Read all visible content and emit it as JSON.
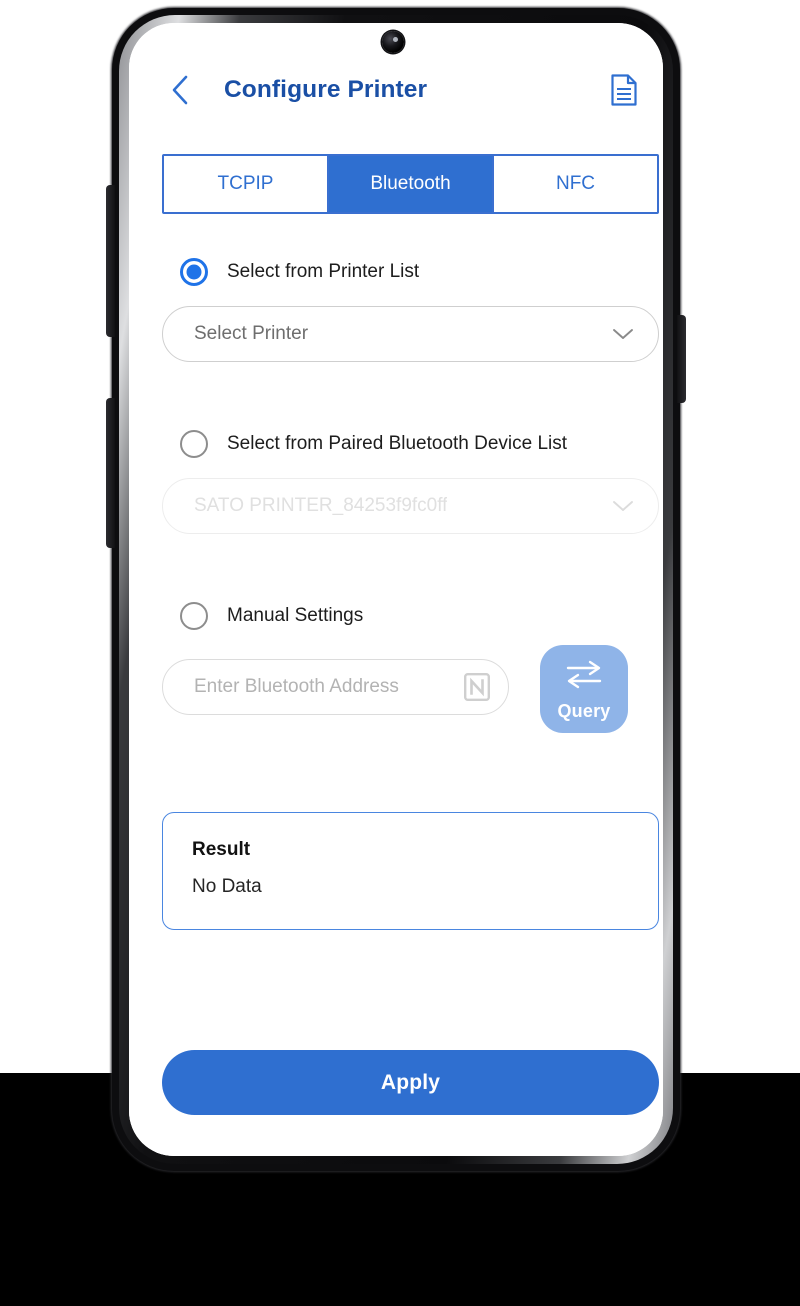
{
  "device": {
    "type": "smartphone",
    "camera": "front-camera-punch-hole"
  },
  "header": {
    "back_icon": "chevron-left-icon",
    "title": "Configure Printer",
    "action_icon": "document-icon"
  },
  "tabs": [
    {
      "label": "TCPIP",
      "active": false
    },
    {
      "label": "Bluetooth",
      "active": true
    },
    {
      "label": "NFC",
      "active": false
    }
  ],
  "options": [
    {
      "label": "Select from Printer List",
      "selected": true,
      "dropdown": {
        "value": "Select Printer",
        "disabled": false,
        "icon": "chevron-down-icon"
      }
    },
    {
      "label": "Select from Paired Bluetooth Device List",
      "selected": false,
      "dropdown": {
        "value": "SATO PRINTER_84253f9fc0ff",
        "disabled": true,
        "icon": "chevron-down-icon"
      }
    },
    {
      "label": "Manual Settings",
      "selected": false
    }
  ],
  "manual": {
    "address_value": "",
    "address_placeholder": "Enter Bluetooth Address",
    "nfc_icon": "nfc-icon",
    "query": {
      "label": "Query",
      "icon": "swap-arrows-icon"
    }
  },
  "result": {
    "title": "Result",
    "value": "No Data"
  },
  "apply": {
    "label": "Apply"
  },
  "colors": {
    "primary_blue": "#2f6fd0",
    "title_blue": "#1a4fa5",
    "radio_blue": "#1f73e8",
    "query_blue": "#8fb4e8",
    "result_border": "#4a86e0",
    "placeholder_gray": "#b3b3b3",
    "disabled_gray": "#e0e0e0"
  }
}
